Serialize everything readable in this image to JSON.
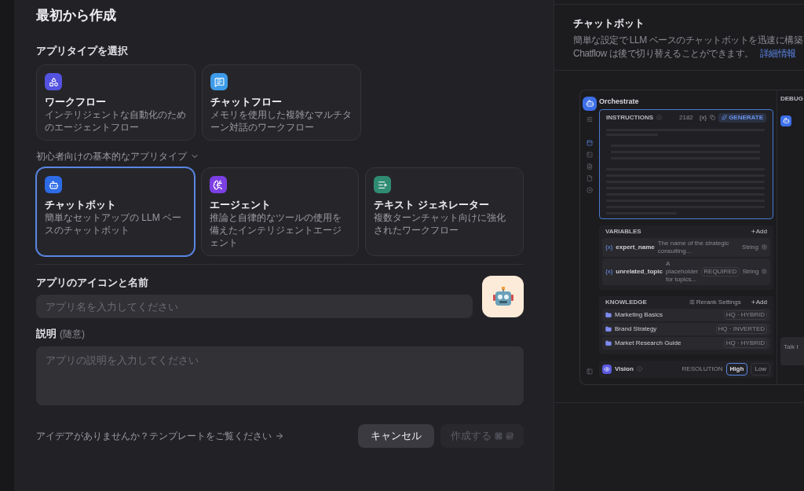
{
  "header": {
    "title": "最初から作成"
  },
  "app_type": {
    "heading": "アプリタイプを選択",
    "types": [
      {
        "kind": "workflow",
        "color": "#5452e0",
        "title": "ワークフロー",
        "description": "インテリジェントな自動化のためのエージェントフロー",
        "selected": false
      },
      {
        "kind": "chatflow",
        "color": "#3d9be9",
        "title": "チャットフロー",
        "description": "メモリを使用した複雑なマルチターン対話のワークフロー",
        "selected": false
      }
    ],
    "basic_toggle": "初心者向けの基本的なアプリタイプ",
    "expanded": true,
    "basic_types": [
      {
        "kind": "chatbot",
        "color": "#2e6be6",
        "title": "チャットボット",
        "description": "簡単なセットアップの LLM ベースのチャットボット",
        "selected": true
      },
      {
        "kind": "agent",
        "color": "#7b3fe4",
        "title": "エージェント",
        "description": "推論と自律的なツールの使用を備えたインテリジェントエージェント",
        "selected": false
      },
      {
        "kind": "text",
        "color": "#2f8c72",
        "title": "テキスト ジェネレーター",
        "description": "複数ターンチャット向けに強化されたワークフロー",
        "selected": false
      }
    ]
  },
  "name_field": {
    "label": "アプリのアイコンと名前",
    "placeholder": "アプリ名を入力してください"
  },
  "description_field": {
    "label": "説明",
    "hint": "(随意)",
    "placeholder": "アプリの説明を入力してください"
  },
  "footer": {
    "template_link": "アイデアがありませんか？テンプレートをご覧ください",
    "cancel": "キャンセル",
    "create": "作成する",
    "create_disabled": true
  },
  "preview": {
    "title": "チャットボット",
    "description_lines": [
      "簡単な設定で LLM ベースのチャットボットを迅速に構築",
      "Chatflow は後で切り替えることができます。"
    ],
    "link": "詳細情報",
    "mock": {
      "title": "Orchestrate",
      "instructions": {
        "label": "INSTRUCTIONS",
        "count": "2182",
        "variable_button": "{x}",
        "generate": "GENERATE"
      },
      "variables": {
        "label": "VARIABLES",
        "add": "Add",
        "items": [
          {
            "icon_text": "{x}",
            "name": "expert_name",
            "description": "The name of the strategic consulting...",
            "type": "String"
          },
          {
            "icon_text": "{x}",
            "name": "unrelated_topic",
            "description": "A placeholder for topics...",
            "badge": "REQUIRED",
            "type": "String"
          }
        ]
      },
      "knowledge": {
        "label": "KNOWLEDGE",
        "rerank": "Rerank Settings",
        "add": "Add",
        "items": [
          {
            "name": "Marketing Basics",
            "tag": "HQ · HYBRID"
          },
          {
            "name": "Brand Strategy",
            "tag": "HQ · INVERTED"
          },
          {
            "name": "Market Research Guide",
            "tag": "HQ · HYBRID"
          }
        ]
      },
      "vision": {
        "label": "Vision",
        "resolution_label": "RESOLUTION",
        "options": [
          {
            "label": "High",
            "selected": true
          },
          {
            "label": "Low",
            "selected": false
          }
        ]
      },
      "debug": {
        "label": "DEBUG",
        "input_placeholder": "Talk t"
      }
    }
  }
}
